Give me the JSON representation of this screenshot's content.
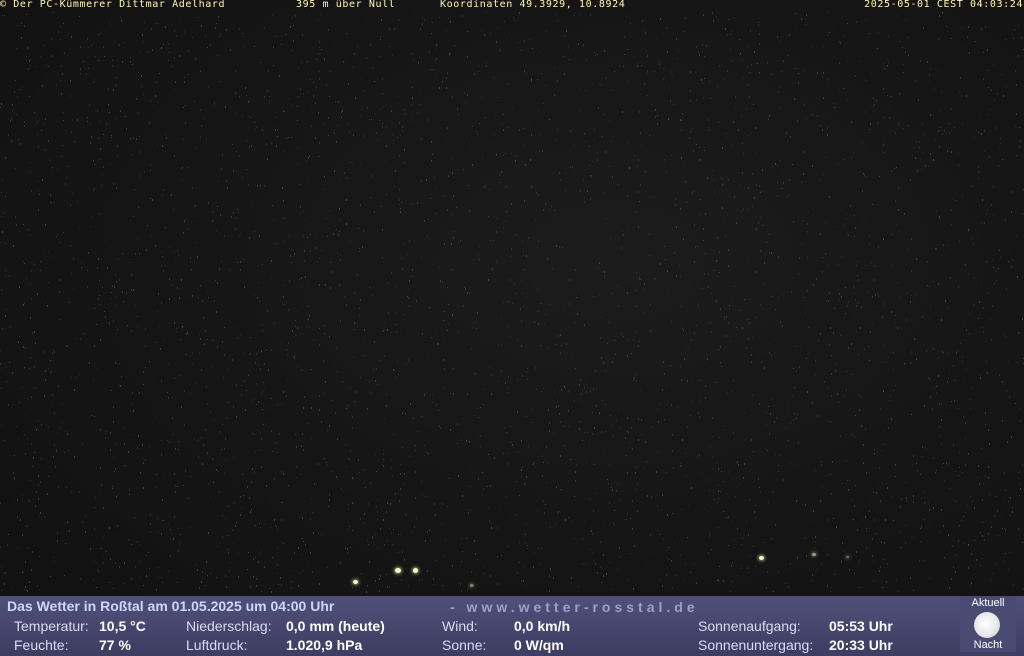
{
  "overlay": {
    "copyright": "© Der PC-Kümmerer Dittmar Adelhard",
    "altitude": "395 m über Null",
    "coordinates": "Koordinaten 49.3929, 10.8924",
    "timestamp": "2025-05-01 CEST 04:03:24"
  },
  "weather": {
    "title": "Das Wetter in Roßtal am 01.05.2025 um 04:00 Uhr",
    "website": "- www.wetter-rosstal.de",
    "temperature_label": "Temperatur:",
    "temperature_value": "10,5 °C",
    "humidity_label": "Feuchte:",
    "humidity_value": "77 %",
    "precipitation_label": "Niederschlag:",
    "precipitation_value": "0,0 mm (heute)",
    "pressure_label": "Luftdruck:",
    "pressure_value": "1.020,9 hPa",
    "wind_label": "Wind:",
    "wind_value": "0,0 km/h",
    "sun_label": "Sonne:",
    "sun_value": "0 W/qm",
    "sunrise_label": "Sonnenaufgang:",
    "sunrise_value": "05:53 Uhr",
    "sunset_label": "Sonnenuntergang:",
    "sunset_value": "20:33 Uhr"
  },
  "moon": {
    "top_label": "Aktuell",
    "bottom_label": "Nacht"
  },
  "colors": {
    "overlay_text": "#fff8b0",
    "panel_background": "#46466c",
    "title_text": "#cfd6ff"
  }
}
